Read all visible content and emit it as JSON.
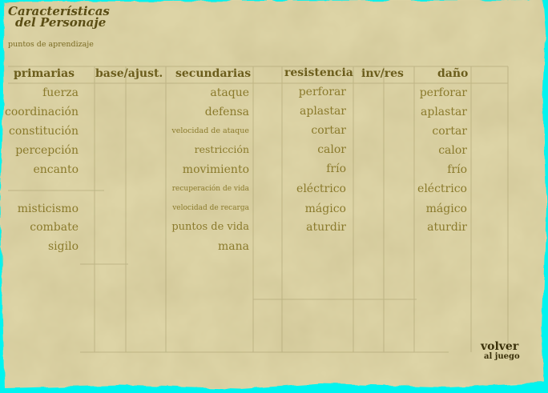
{
  "title_line1": "Características",
  "title_line2": "del Personaje",
  "learning_points_label": "puntos de aprendizaje",
  "headers": {
    "primarias": "primarias",
    "base": "base/ajust.",
    "secundarias": "secundarias",
    "resistencia": "resistencia",
    "invres": "inv/res",
    "dano": "daño"
  },
  "primarias": [
    "fuerza",
    "coordinación",
    "constitución",
    "percepción",
    "encanto"
  ],
  "primarias2": [
    "misticismo",
    "combate",
    "sigilo"
  ],
  "secundarias": [
    "ataque",
    "defensa",
    "velocidad de ataque",
    "restricción",
    "movimiento",
    "recuperación de vida",
    "velocidad de recarga",
    "puntos de vida",
    "mana"
  ],
  "resistencia": [
    "perforar",
    "aplastar",
    "cortar",
    "calor",
    "frío",
    "eléctrico",
    "mágico",
    "aturdir"
  ],
  "dano": [
    "perforar",
    "aplastar",
    "cortar",
    "calor",
    "frío",
    "eléctrico",
    "mágico",
    "aturdir"
  ],
  "back_line1": "volver",
  "back_line2": "al juego",
  "colors": {
    "parchment": "#ddd4a6",
    "text": "#8a7a2c",
    "title": "#5a4d14",
    "background": "#00f4f0"
  }
}
